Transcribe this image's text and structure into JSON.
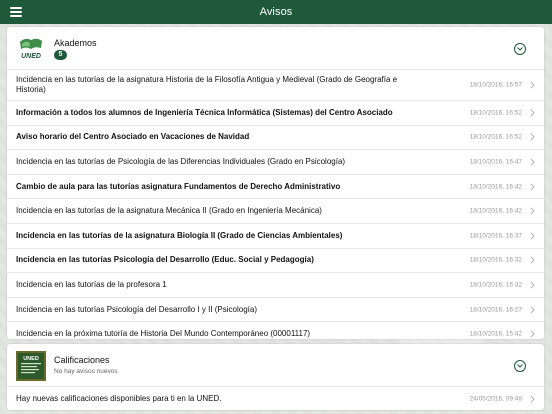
{
  "header": {
    "title": "Avisos",
    "menu_icon": "hamburger-menu-icon",
    "bar_color": "#1e5a3a"
  },
  "akademos": {
    "title": "Akademos",
    "badge": "5",
    "logo_text": "UNED",
    "expand_icon": "chevron-down-circle-icon",
    "items": [
      {
        "text": "Incidencia en las tutorías de la asignatura Historia de la Filosofía Antigua y Medieval (Grado de Geografía e Historia)",
        "date": "18/10/2016, 16:57",
        "bold": false
      },
      {
        "text": "Información a todos los alumnos de Ingeniería Técnica Informática (Sistemas) del Centro Asociado",
        "date": "18/10/2016, 16:52",
        "bold": true
      },
      {
        "text": "Aviso horario del Centro Asociado en Vacaciones de Navidad",
        "date": "18/10/2016, 16:52",
        "bold": true
      },
      {
        "text": "Incidencia en las tutorías de Psicología de las Diferencias Individuales (Grado en Psicología)",
        "date": "18/10/2016, 16:47",
        "bold": false
      },
      {
        "text": "Cambio de aula para las tutorías asignatura Fundamentos de Derecho Administrativo",
        "date": "18/10/2016, 16:42",
        "bold": true
      },
      {
        "text": "Incidencia en las tutorías de la asignatura Mecánica II (Grado en Ingeniería Mecánica)",
        "date": "18/10/2016, 16:42",
        "bold": false
      },
      {
        "text": "Incidencia en las tutorías de la asignatura Biología II (Grado de Ciencias Ambientales)",
        "date": "18/10/2016, 16:37",
        "bold": true
      },
      {
        "text": "Incidencia en las tutorías Psicología del Desarrollo (Educ. Social y Pedagogía)",
        "date": "18/10/2016, 16:32",
        "bold": true
      },
      {
        "text": "Incidencia en las tutorías de la profesora 1",
        "date": "18/10/2016, 16:32",
        "bold": false
      },
      {
        "text": "Incidencia en las tutorías Psicología del Desarrollo I y II (Psicología)",
        "date": "18/10/2016, 16:27",
        "bold": false
      },
      {
        "text": "Incidencia en la próxima tutoría de Historia Del Mundo Contemporáneo (00001117)",
        "date": "18/10/2016, 15:42",
        "bold": false
      }
    ]
  },
  "calificaciones": {
    "title": "Calificaciones",
    "subtitle": "No hay avisos nuevos",
    "logo_text": "UNED",
    "expand_icon": "chevron-down-circle-icon",
    "items": [
      {
        "text": "Hay nuevas calificaciones disponibles para ti en la UNED.",
        "date": "24/05/2016, 09:48",
        "bold": false
      }
    ]
  }
}
